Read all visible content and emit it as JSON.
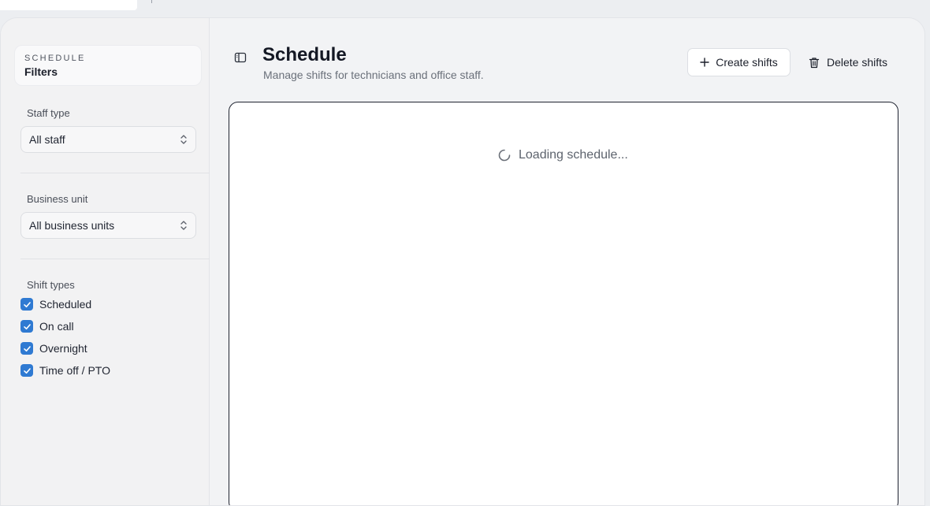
{
  "sidebar": {
    "eyebrow": "SCHEDULE",
    "title": "Filters",
    "staff_type": {
      "label": "Staff type",
      "value": "All staff"
    },
    "business_unit": {
      "label": "Business unit",
      "value": "All business units"
    },
    "shift_types": {
      "label": "Shift types",
      "items": [
        {
          "label": "Scheduled",
          "checked": true
        },
        {
          "label": "On call",
          "checked": true
        },
        {
          "label": "Overnight",
          "checked": true
        },
        {
          "label": "Time off / PTO",
          "checked": true
        }
      ]
    }
  },
  "header": {
    "title": "Schedule",
    "subtitle": "Manage shifts for technicians and office staff.",
    "create_label": "Create shifts",
    "delete_label": "Delete shifts"
  },
  "schedule": {
    "loading_text": "Loading schedule..."
  },
  "icons": {
    "panel": "panel-toggle-icon",
    "plus": "plus-icon",
    "trash": "trash-icon",
    "spinner": "spinner-icon",
    "chevron": "chevron-up-down-icon",
    "check": "check-icon"
  },
  "colors": {
    "accent": "#2f7ad2"
  }
}
